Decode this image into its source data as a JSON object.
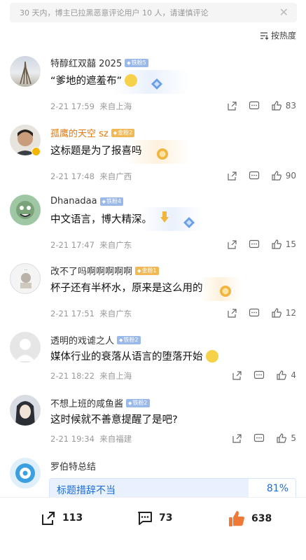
{
  "notice": {
    "text": "30 天内，博主已拉黑恶意评论用户 10 人，请谨慎评论"
  },
  "sort": {
    "label": "按热度"
  },
  "comments": [
    {
      "user": "特醇红双囍 2025",
      "badge": "铁粉5",
      "badge_type": "blue",
      "text": "“爹地的遮羞布”",
      "date": "2-21 17:59",
      "location": "来自上海",
      "likes": "83"
    },
    {
      "user": "孤鹰的天空 sz",
      "badge": "金粉2",
      "badge_type": "gold",
      "text": "这标题是为了报喜吗",
      "date": "2-21 17:48",
      "location": "来自广西",
      "likes": "90"
    },
    {
      "user": "Dhanadaa",
      "badge": "铁粉4",
      "badge_type": "blue",
      "text": "中文语言，博大精深。",
      "date": "2-21 17:47",
      "location": "来自广东",
      "likes": "15"
    },
    {
      "user": "改不了吗啊啊啊啊啊",
      "badge": "金粉1",
      "badge_type": "gold",
      "text": "杯子还有半杯水，原来是这么用的",
      "date": "2-21 17:51",
      "location": "来自广东",
      "likes": "12"
    },
    {
      "user": "透明的戏谑之人",
      "badge": "铁粉2",
      "badge_type": "blue",
      "text": "媒体行业的衰落从语言的堕落开始",
      "date": "2-21 18:22",
      "location": "来自上海",
      "likes": "4"
    },
    {
      "user": "不想上班的咸鱼酱",
      "badge": "铁粉2",
      "badge_type": "blue",
      "text": "这时候就不善意提醒了是吧?",
      "date": "2-21 19:34",
      "location": "来自福建",
      "likes": "5"
    }
  ],
  "poll_comment": {
    "user": "罗伯特总结",
    "option": "标题措辞不当",
    "percent_label": "81%",
    "percent": 0.81
  },
  "bottom": {
    "share": "113",
    "comments": "73",
    "likes": "638"
  },
  "colors": {
    "accent_blue": "#1f6bd8",
    "username_orange": "#e8760a",
    "like_orange": "#f07a35"
  }
}
